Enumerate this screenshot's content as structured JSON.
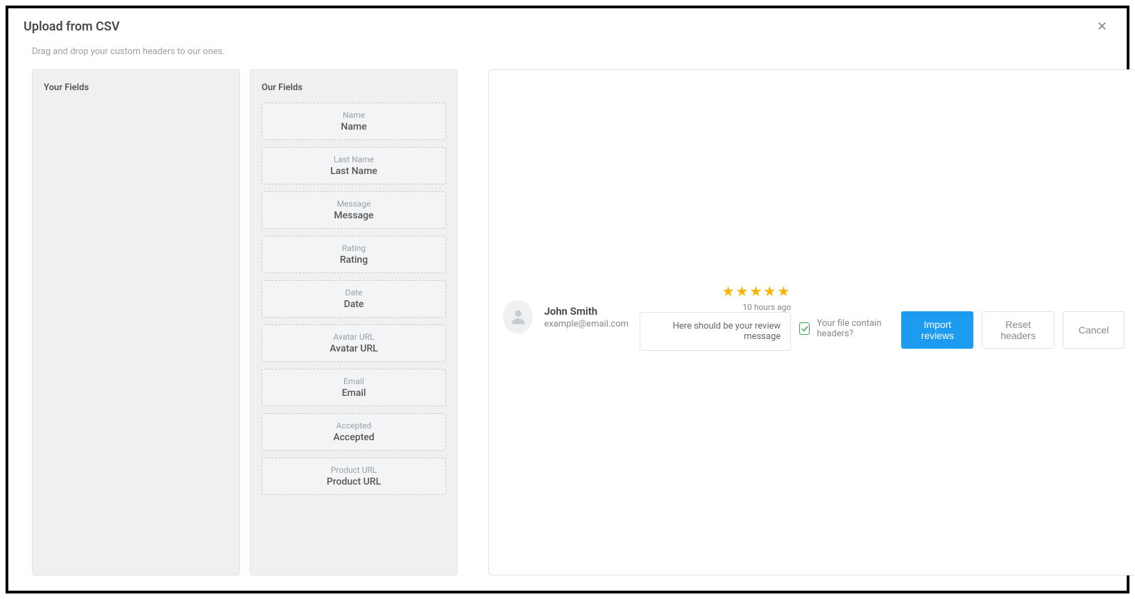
{
  "title": "Upload from CSV",
  "subtitle": "Drag and drop your custom headers to our ones.",
  "your_fields_title": "Your Fields",
  "our_fields_title": "Our Fields",
  "our_fields": [
    {
      "label": "Name",
      "value": "Name"
    },
    {
      "label": "Last Name",
      "value": "Last Name"
    },
    {
      "label": "Message",
      "value": "Message"
    },
    {
      "label": "Rating",
      "value": "Rating"
    },
    {
      "label": "Date",
      "value": "Date"
    },
    {
      "label": "Avatar URL",
      "value": "Avatar URL"
    },
    {
      "label": "Email",
      "value": "Email"
    },
    {
      "label": "Accepted",
      "value": "Accepted"
    },
    {
      "label": "Product URL",
      "value": "Product URL"
    }
  ],
  "preview": {
    "name": "John Smith",
    "email": "example@email.com",
    "stars": "★★★★★",
    "time": "10 hours ago",
    "message": "Here should be your review message"
  },
  "checkbox_label": "Your file contain headers?",
  "checkbox_checked": true,
  "buttons": {
    "import": "Import reviews",
    "reset": "Reset headers",
    "cancel": "Cancel"
  }
}
